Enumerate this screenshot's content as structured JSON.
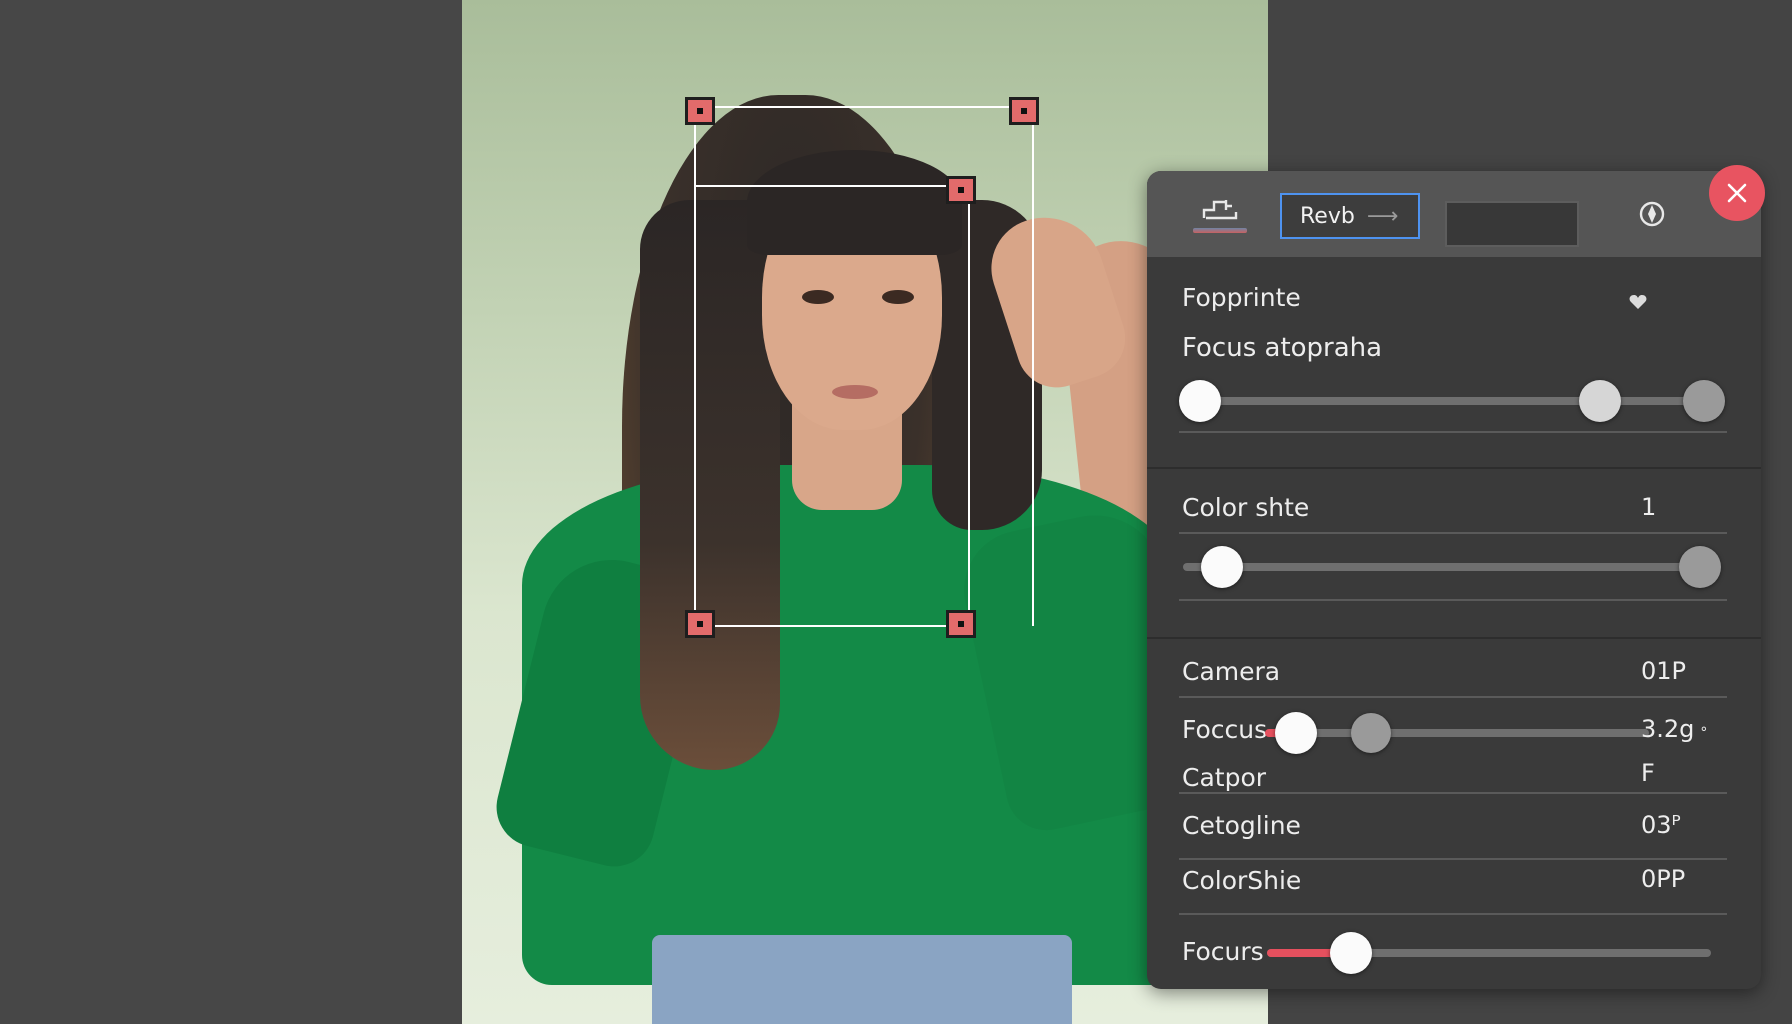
{
  "toolbar": {
    "rev_label": "Revb",
    "rev_arrow": "⟶",
    "crop_icon": "crop-tool-icon",
    "target_icon": "target-icon",
    "close_icon": "close-icon"
  },
  "panel": {
    "preset_title": "Fopprinte",
    "favorite_icon": "heart-icon",
    "focus_label": "Focus atopraha",
    "color_label": "Color shte",
    "color_value": "1",
    "camera": {
      "label": "Camera",
      "value": "01P"
    },
    "foccus": {
      "label": "Foccus",
      "value": "3.2g",
      "unit": "°"
    },
    "catpor": {
      "label": "Catpor",
      "value": "F"
    },
    "cetogline": {
      "label": "Cetogline",
      "value": "03ᴾ"
    },
    "colorshie": {
      "label": "ColorShie",
      "value": "0PP"
    },
    "focurs": {
      "label": "Focurs"
    }
  },
  "colors": {
    "accent_red": "#e5505e",
    "accent_blue": "#4e93f0",
    "panel_bg": "#3a3a3a",
    "toolbar_bg": "#555555",
    "app_bg": "#474747",
    "shirt_green": "#138a47"
  },
  "sliders": {
    "focus_range": {
      "low": 0.0,
      "high": 0.78,
      "end": 1.0
    },
    "color_shift": {
      "value": 0.06
    },
    "foccus": {
      "value": 0.08,
      "secondary": 0.27
    },
    "focurs": {
      "value": 0.24
    }
  }
}
